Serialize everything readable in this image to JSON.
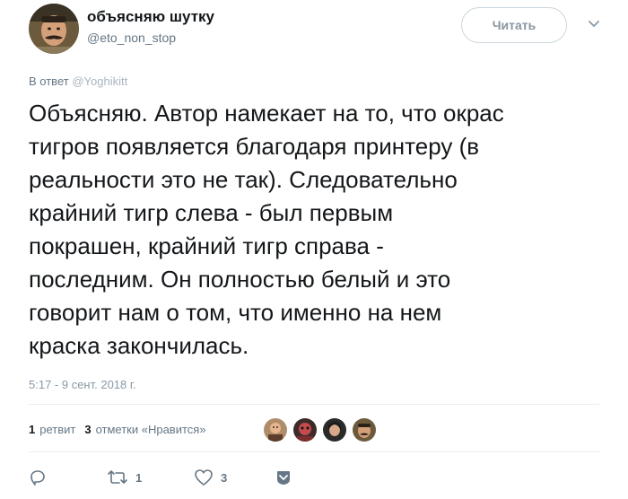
{
  "author": {
    "display_name": "объясняю шутку",
    "handle": "@eto_non_stop"
  },
  "follow_button": {
    "label": "Читать"
  },
  "reply_to": {
    "prefix": "В ответ",
    "mention": "@Yoghikitt"
  },
  "tweet": {
    "text": "Объясняю. Автор намекает на то, что окрас\nтигров появляется благодаря принтеру (в\nреальности это не так). Следовательно\nкрайний тигр слева - был первым\nпокрашен, крайний тигр справа -\nпоследним. Он полностью белый и это\nговорит нам о том, что именно на нем\nкраска закончилась.",
    "timestamp": "5:17 - 9 сент. 2018 г."
  },
  "stats": {
    "retweets": {
      "count": "1",
      "label": "ретвит"
    },
    "likes": {
      "count": "3",
      "label": "отметки «Нравится»"
    }
  },
  "actions": {
    "reply": {
      "icon": "reply-icon"
    },
    "retweet": {
      "icon": "retweet-icon",
      "count": "1"
    },
    "like": {
      "icon": "heart-icon",
      "count": "3"
    },
    "dm": {
      "icon": "direct-message-icon"
    }
  },
  "colors": {
    "text": "#14171a",
    "secondary": "#657786",
    "border": "#e6ecf0",
    "button_border": "#ccd6dd"
  }
}
